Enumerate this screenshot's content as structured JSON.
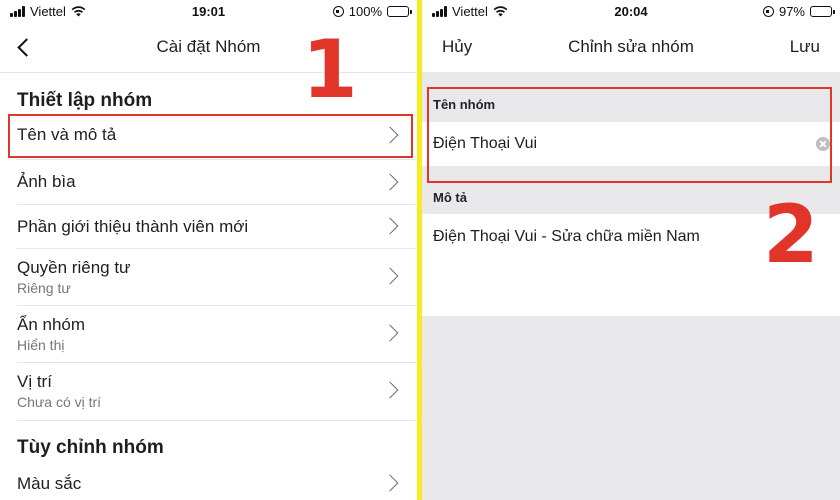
{
  "left_screen": {
    "status": {
      "carrier": "Viettel",
      "time": "19:01",
      "battery": "100%",
      "battery_level": 1.0
    },
    "nav": {
      "title": "Cài đặt Nhóm"
    },
    "sections": [
      {
        "title": "Thiết lập nhóm",
        "items": [
          {
            "label": "Tên và mô tả"
          },
          {
            "label": "Ảnh bìa"
          },
          {
            "label": "Phần giới thiệu thành viên mới"
          },
          {
            "label": "Quyền riêng tư",
            "sub": "Riêng tư"
          },
          {
            "label": "Ẩn nhóm",
            "sub": "Hiển thị"
          },
          {
            "label": "Vị trí",
            "sub": "Chưa có vị trí"
          }
        ]
      },
      {
        "title": "Tùy chỉnh nhóm",
        "items": [
          {
            "label": "Màu sắc"
          }
        ]
      }
    ],
    "annotation_number": "1"
  },
  "right_screen": {
    "status": {
      "carrier": "Viettel",
      "time": "20:04",
      "battery": "97%",
      "battery_level": 0.97
    },
    "nav": {
      "cancel": "Hủy",
      "title": "Chỉnh sửa nhóm",
      "save": "Lưu"
    },
    "name_field": {
      "label": "Tên nhóm",
      "value": "Điện Thoại Vui"
    },
    "desc_field": {
      "label": "Mô tả",
      "value": "Điện Thoại Vui - Sửa chữa miền Nam"
    },
    "annotation_number": "2"
  },
  "colors": {
    "annotation_red": "#e2352a",
    "divider_yellow": "#f3ec1f",
    "panel_gray": "#e9e9ec"
  }
}
